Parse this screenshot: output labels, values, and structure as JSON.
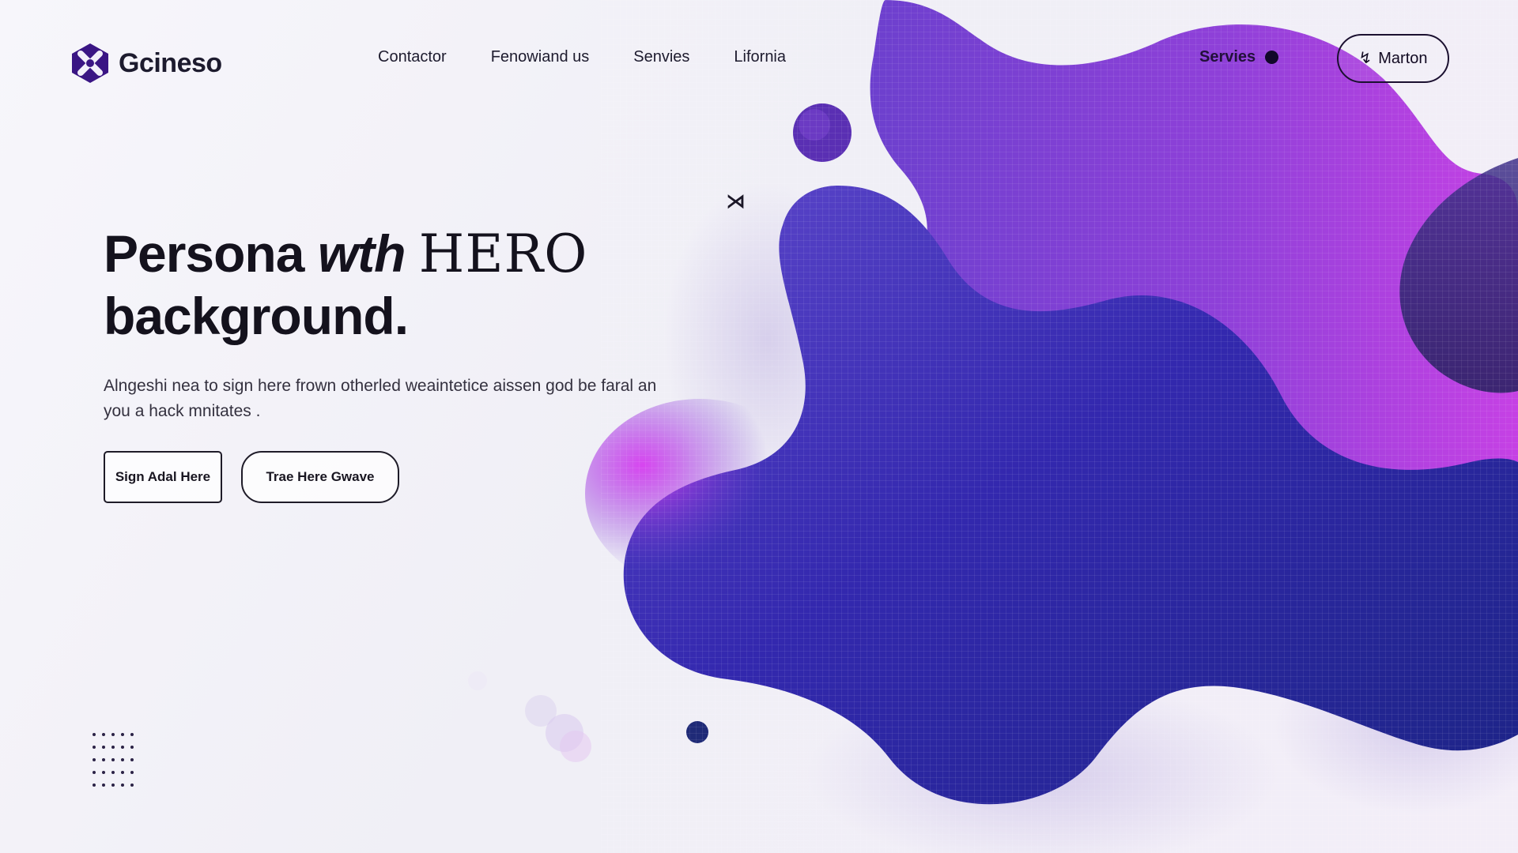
{
  "brand": {
    "name": "Gcineso",
    "logo_icon": "x-badge-icon",
    "brand_color": "#3a1584"
  },
  "nav": {
    "links": [
      "Contactor",
      "Fenowiand us",
      "Senvies",
      "Lifornia"
    ],
    "right_link": "Servies",
    "account_button": "Marton",
    "account_icon": "arrow-icon"
  },
  "hero": {
    "title_part1": "Persona",
    "title_italic": "wth",
    "title_serif": "HERO",
    "title_line2": "background.",
    "subtitle": "Alngeshi nea to sign here frown otherled weaintetice aissen god be faral an you a hack mnitates .",
    "primary_cta": "Sign Adal Here",
    "secondary_cta": "Trae Here Gwave",
    "cursor_symbol": "⋊"
  },
  "colors": {
    "accent_magenta": "#b23ee2",
    "accent_purple": "#6d3dd0",
    "accent_indigo": "#2d24a9",
    "accent_navy": "#1b2d8c",
    "dark_text": "#14121d"
  }
}
